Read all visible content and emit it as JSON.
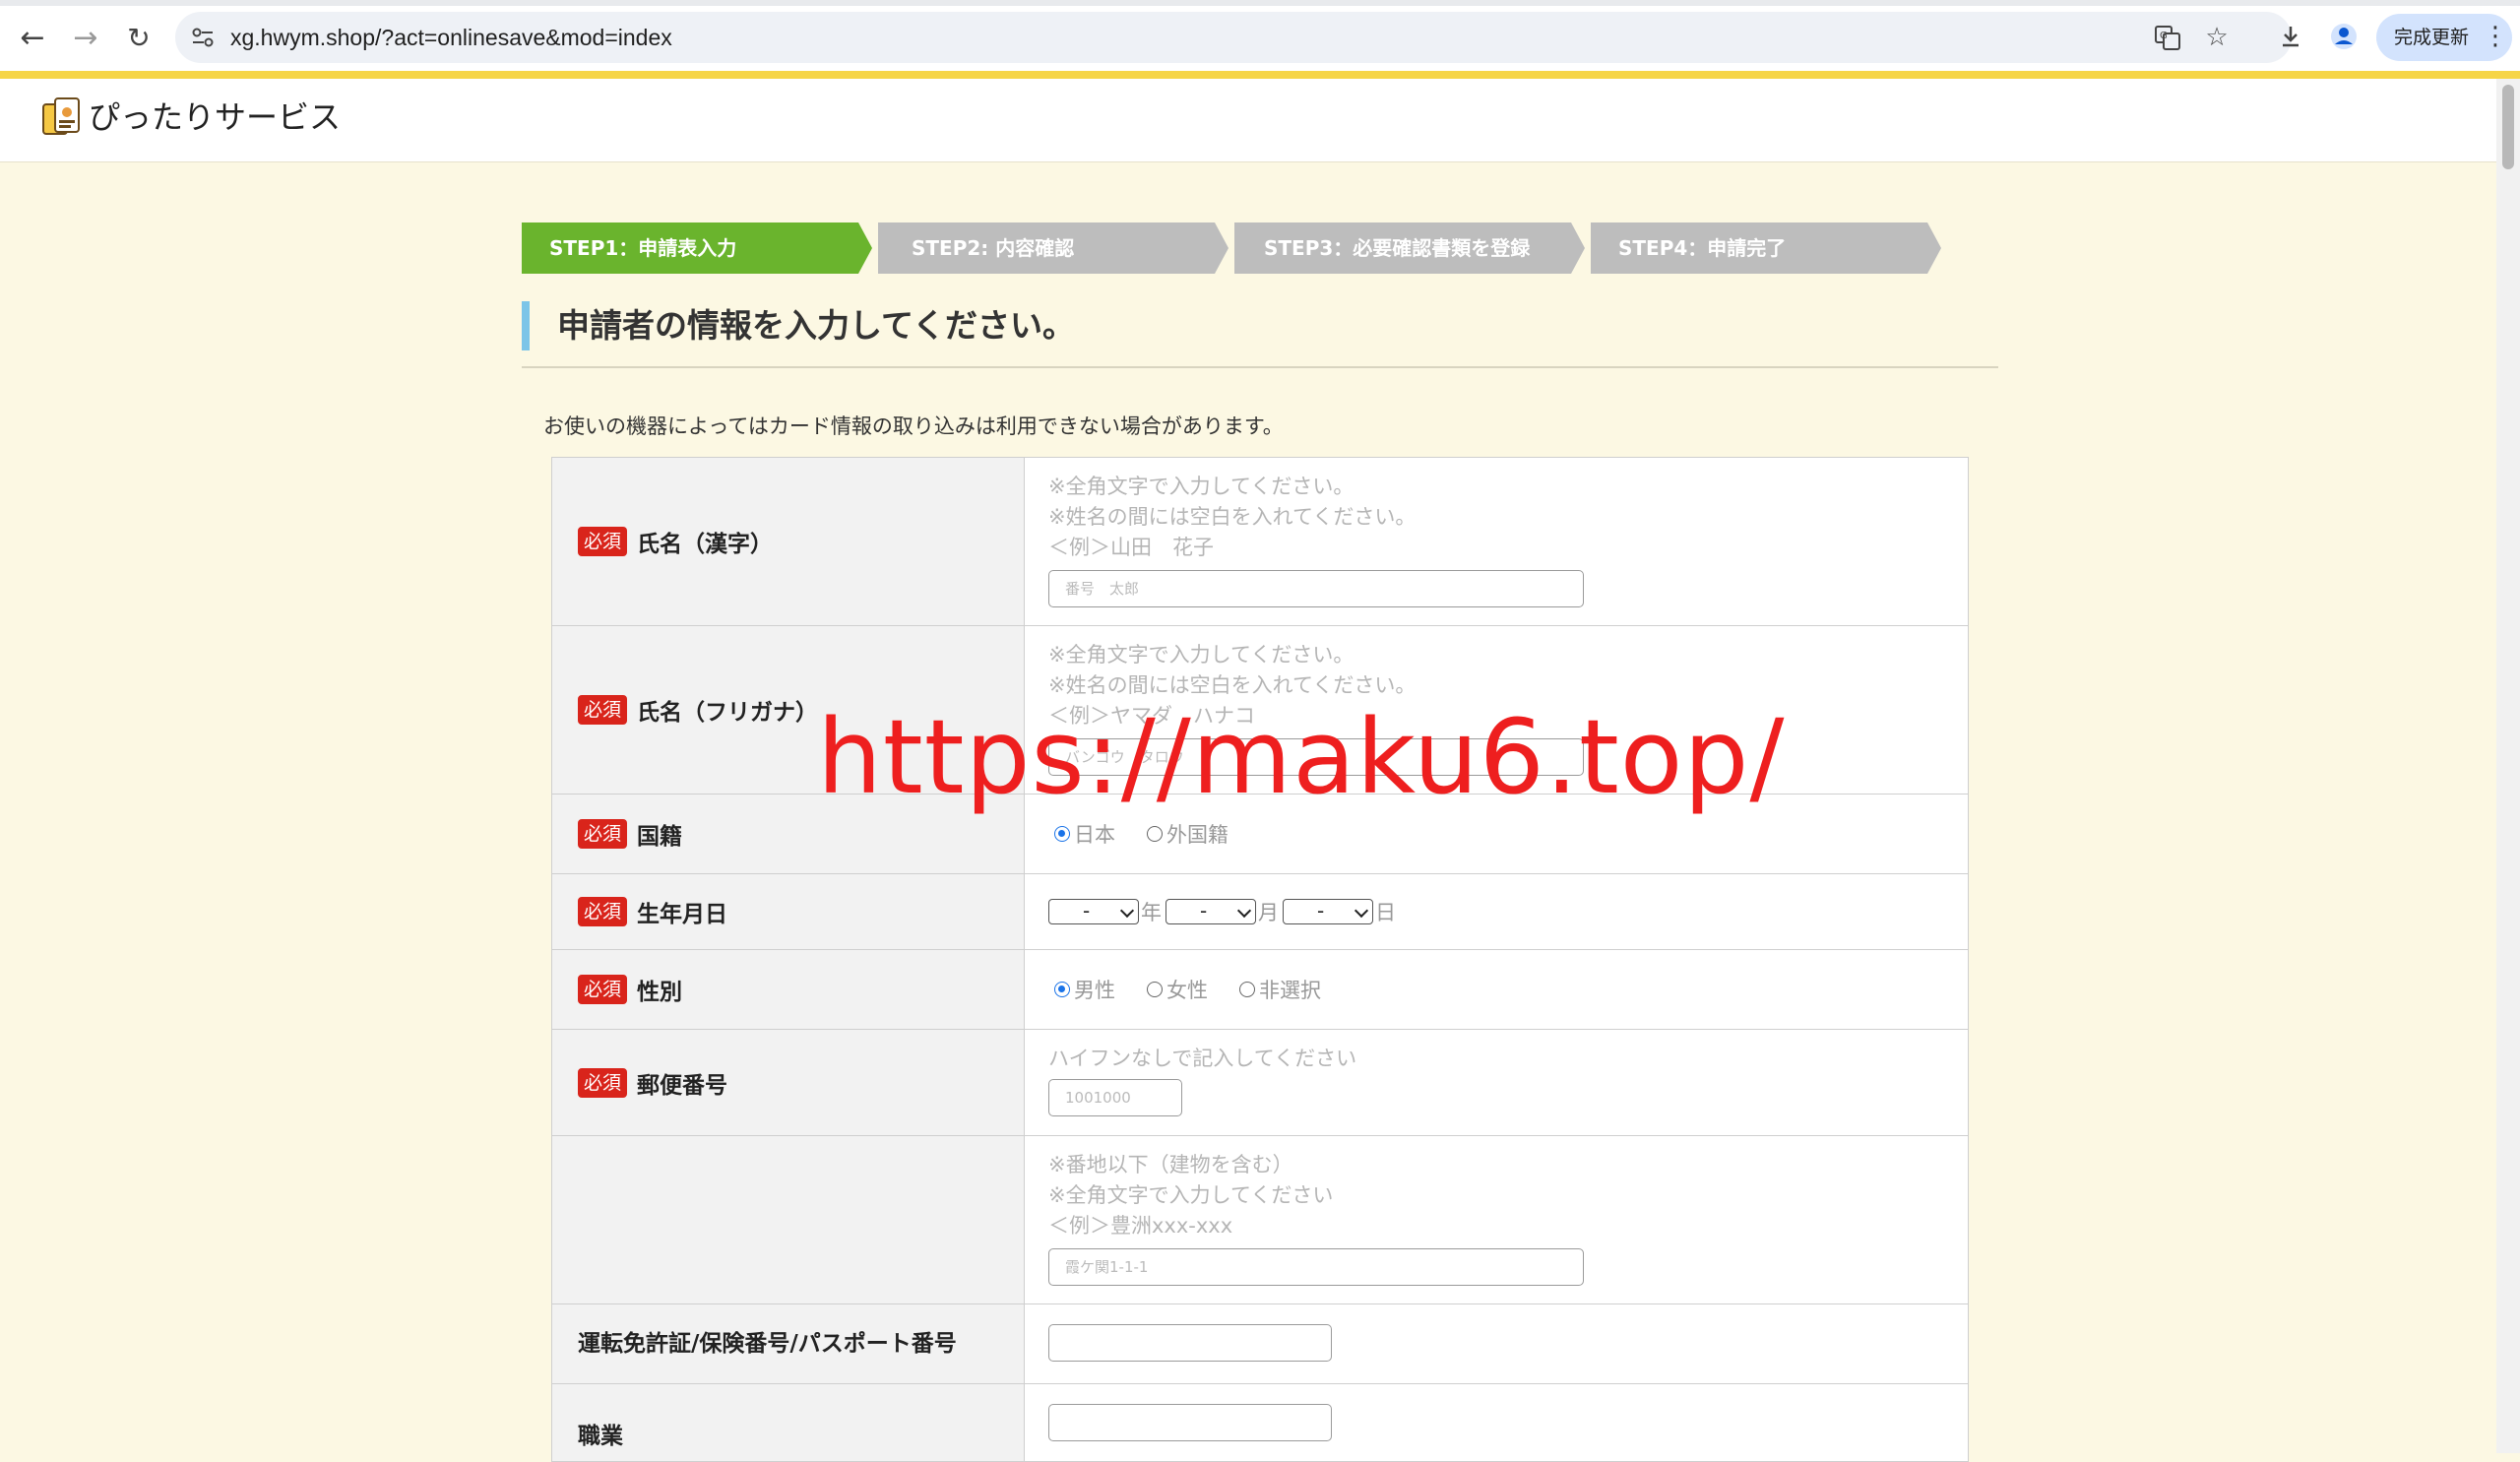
{
  "browser": {
    "url": "xg.hwym.shop/?act=onlinesave&mod=index",
    "update_button": "完成更新"
  },
  "site": {
    "name": "ぴったりサービス"
  },
  "steps": [
    {
      "label": "STEP1：申請表入力",
      "color": "#6ab42d"
    },
    {
      "label": "STEP2: 内容確認",
      "color": "#bdbdbd"
    },
    {
      "label": "STEP3：必要確認書類を登録",
      "color": "#bdbdbd"
    },
    {
      "label": "STEP4：申請完了",
      "color": "#bdbdbd"
    }
  ],
  "page": {
    "heading": "申請者の情報を入力してください。",
    "notice": "お使いの機器によってはカード情報の取り込みは利用できない場合があります。"
  },
  "required_badge": "必須",
  "form": {
    "name_kanji": {
      "label": "氏名（漢字）",
      "hints": [
        "※全角文字で入力してください。",
        "※姓名の間には空白を入れてください。",
        "＜例＞山田　花子"
      ],
      "placeholder": "番号　太郎"
    },
    "name_kana": {
      "label": "氏名（フリガナ）",
      "hints": [
        "※全角文字で入力してください。",
        "※姓名の間には空白を入れてください。",
        "＜例＞ヤマダ　ハナコ"
      ],
      "placeholder": "バンゴウ　タロウ"
    },
    "nationality": {
      "label": "国籍",
      "options": [
        "日本",
        "外国籍"
      ],
      "selected": "日本"
    },
    "birthdate": {
      "label": "生年月日",
      "year_value": "-",
      "year_suffix": "年",
      "month_value": "-",
      "month_suffix": "月",
      "day_value": "-",
      "day_suffix": "日"
    },
    "gender": {
      "label": "性別",
      "options": [
        "男性",
        "女性",
        "非選択"
      ],
      "selected": "男性"
    },
    "postal": {
      "label": "郵便番号",
      "hint": "ハイフンなしで記入してください",
      "placeholder": "1001000"
    },
    "address": {
      "hints": [
        "※番地以下（建物を含む）",
        "※全角文字で入力してください",
        "＜例＞豊洲xxx-xxx"
      ],
      "placeholder": "霞ケ関1-1-1"
    },
    "license": {
      "label": "運転免許証/保険番号/パスポート番号"
    },
    "occupation": {
      "label": "職業"
    }
  },
  "watermark": "https://maku6.top/"
}
